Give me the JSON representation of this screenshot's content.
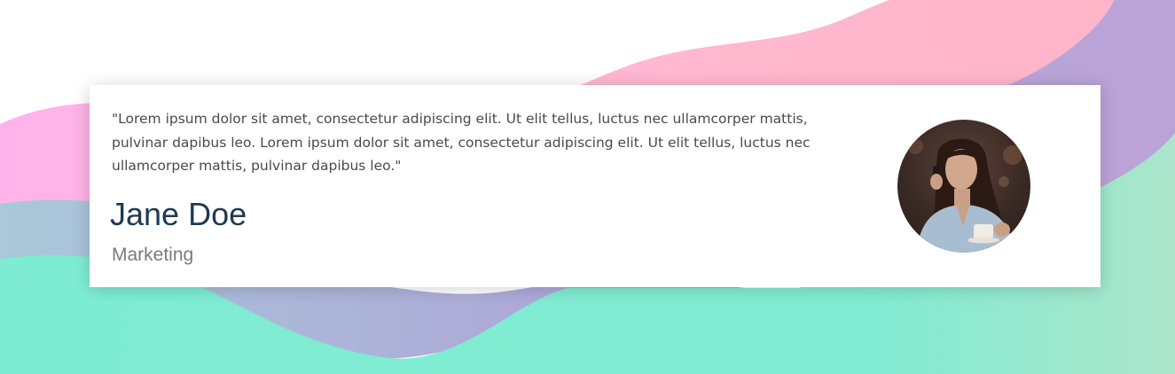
{
  "testimonial": {
    "quote": "\"Lorem ipsum dolor sit amet, consectetur adipiscing elit. Ut elit tellus, luctus nec ullamcorper mattis, pulvinar dapibus leo. Lorem ipsum dolor sit amet, consectetur adipiscing elit. Ut elit tellus, luctus nec ullamcorper mattis, pulvinar dapibus leo.\"",
    "name": "Jane Doe",
    "role": "Marketing",
    "avatar_icon": "person-avatar-photo"
  },
  "colors": {
    "name_text": "#1d3a52",
    "quote_text": "#4a4a4a",
    "role_text": "#7a7a7a",
    "wave_pink": "#ffb5d2",
    "wave_purple": "#b9a3d8",
    "wave_mint": "#7eecd2"
  }
}
